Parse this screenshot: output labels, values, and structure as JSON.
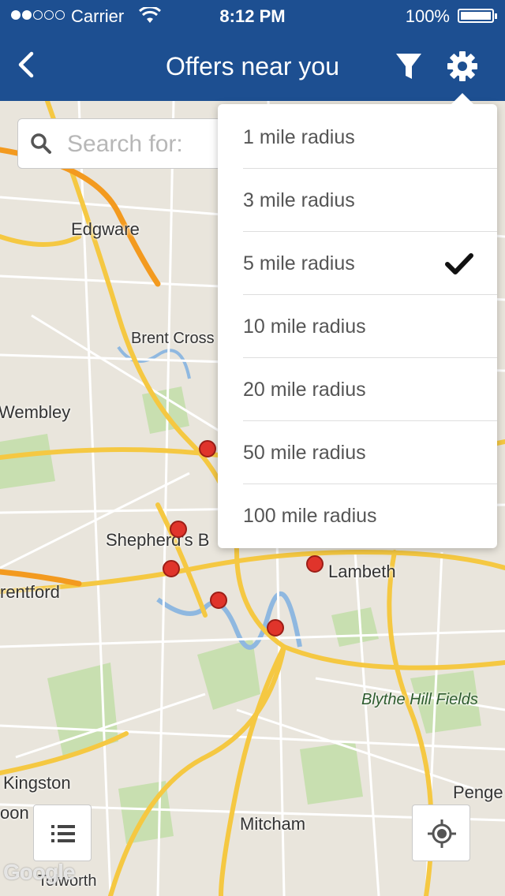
{
  "status_bar": {
    "carrier": "Carrier",
    "time": "8:12 PM",
    "battery": "100%"
  },
  "nav": {
    "title": "Offers near you"
  },
  "search": {
    "placeholder": "Search for:"
  },
  "radius_menu": {
    "options": [
      {
        "label": "1 mile radius",
        "selected": false
      },
      {
        "label": "3 mile radius",
        "selected": false
      },
      {
        "label": "5 mile radius",
        "selected": true
      },
      {
        "label": "10 mile radius",
        "selected": false
      },
      {
        "label": "20 mile radius",
        "selected": false
      },
      {
        "label": "50 mile radius",
        "selected": false
      },
      {
        "label": "100 mile radius",
        "selected": false
      }
    ]
  },
  "map": {
    "places": [
      "Edgware",
      "Brent Cross",
      "Wembley",
      "Shepherd's B",
      "Lambeth",
      "rentford",
      "Blythe Hill Fields",
      "Kingston",
      "Penge",
      "Mitcham",
      "Tolworth",
      "oon"
    ],
    "attribution": "Google"
  },
  "colors": {
    "nav": "#1d4f91",
    "pin": "#e0342b",
    "road": "#f5c842",
    "motorway": "#f39a1f"
  }
}
